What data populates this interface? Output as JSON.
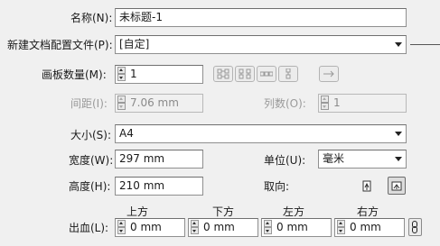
{
  "name": {
    "label": "名称(N):",
    "value": "未标题-1"
  },
  "profile": {
    "label": "新建文档配置文件(P):",
    "value": "[自定]"
  },
  "artboards": {
    "count_label": "画板数量(M):",
    "count_value": "1",
    "spacing_label": "间距(I):",
    "spacing_value": "7.06 mm",
    "columns_label": "列数(O):",
    "columns_value": "1"
  },
  "size": {
    "label": "大小(S):",
    "value": "A4"
  },
  "width": {
    "label": "宽度(W):",
    "value": "297 mm"
  },
  "units": {
    "label": "单位(U):",
    "value": "毫米"
  },
  "height": {
    "label": "高度(H):",
    "value": "210 mm"
  },
  "orientation": {
    "label": "取向:"
  },
  "bleed": {
    "label": "出血(L):",
    "top_label": "上方",
    "top_value": "0 mm",
    "bottom_label": "下方",
    "bottom_value": "0 mm",
    "left_label": "左方",
    "left_value": "0 mm",
    "right_label": "右方",
    "right_value": "0 mm"
  },
  "icons": [
    "grid-by-row-icon",
    "grid-by-column-icon",
    "arrange-by-row-icon",
    "arrange-by-column-icon",
    "right-to-left-arrow-icon",
    "portrait-icon",
    "landscape-icon",
    "chain-link-icon"
  ]
}
